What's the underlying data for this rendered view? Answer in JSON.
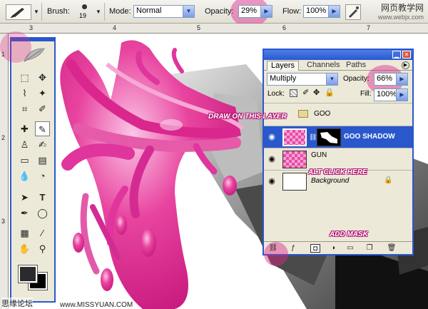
{
  "options_bar": {
    "brush_label": "Brush:",
    "brush_size": "19",
    "mode_label": "Mode:",
    "mode_value": "Normal",
    "opacity_label": "Opacity:",
    "opacity_value": "29%",
    "flow_label": "Flow:",
    "flow_value": "100%",
    "watermark_cn": "网页教学网",
    "watermark_url": "www.webjx.com"
  },
  "ruler": {
    "top_labels": [
      "3",
      "4",
      "5",
      "6",
      "7"
    ],
    "left_labels": [
      "1",
      "2",
      "3"
    ]
  },
  "layers_panel": {
    "tabs": [
      "Layers",
      "Channels",
      "Paths"
    ],
    "active_tab": "Layers",
    "blend_mode": "Multiply",
    "opacity_label": "Opacity:",
    "opacity_value": "66%",
    "lock_label": "Lock:",
    "fill_label": "Fill:",
    "fill_value": "100%",
    "group_name": "GOO",
    "layers": [
      {
        "name": "GOO SHADOW",
        "selected": true
      },
      {
        "name": "GUN",
        "selected": false
      },
      {
        "name": "Background",
        "selected": false
      }
    ]
  },
  "annotations": {
    "draw": "DRAW ON THIS LAYER",
    "alt": "ALT CLICK HERE",
    "mask": "ADD MASK"
  },
  "footer": {
    "left": "思缘论坛",
    "url": "www.MISSYUAN.COM"
  },
  "colors": {
    "accent": "#2a58cc",
    "highlight": "#dc288c",
    "goo": "#e0359c"
  }
}
